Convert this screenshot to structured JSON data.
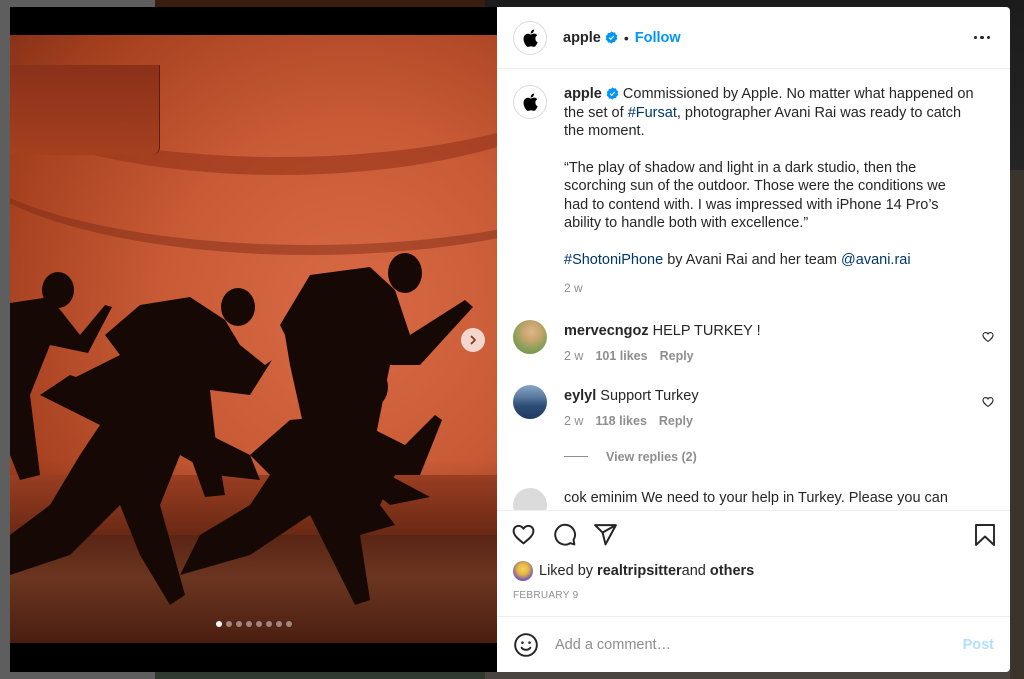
{
  "post": {
    "author": "apple",
    "verified": true,
    "separator": "•",
    "follow_label": "Follow",
    "media": {
      "slide_count": 8,
      "active_slide": 1
    },
    "caption": {
      "username": "apple",
      "line1": " Commissioned by Apple. No matter what happened on the set of ",
      "hashtag1": "#Fursat",
      "line1b": ", photographer Avani Rai was ready to catch the moment.",
      "quote": "“The play of shadow and light in a dark studio, then the scorching sun of the outdoor. Those were the conditions we had to contend with. I was impressed with iPhone 14 Pro’s ability to handle both with excellence.”",
      "hashtag2": "#ShotoniPhone",
      "by_text": " by Avani Rai and her team ",
      "mention": "@avani.rai",
      "time": "2 w"
    },
    "comments": [
      {
        "username": "mervecngoz",
        "text": " HELP TURKEY !",
        "time": "2 w",
        "likes": "101 likes",
        "reply": "Reply"
      },
      {
        "username": "eylyl",
        "text": " Support Turkey",
        "time": "2 w",
        "likes": "118 likes",
        "reply": "Reply"
      }
    ],
    "view_replies": "View replies (2)",
    "cut_comment": "cok eminim We need to your help in Turkey. Please you can",
    "liked_by": {
      "prefix": "Liked by ",
      "user": "realtripsitter",
      "middle": " and ",
      "others": "others"
    },
    "date": "FEBRUARY 9",
    "add_comment": {
      "placeholder": "Add a comment…",
      "value": "",
      "post_label": "Post"
    }
  },
  "colors": {
    "accent": "#0095f6",
    "link": "#00376b",
    "muted": "#8e8e8e",
    "post_disabled": "#b2dffc"
  },
  "icons": {
    "header_more": "more-horizontal-icon",
    "next": "chevron-right-icon",
    "like": "heart-icon",
    "comment": "comment-bubble-icon",
    "share": "paper-plane-icon",
    "save": "bookmark-icon",
    "emoji": "smiley-icon",
    "verified": "verified-badge-icon"
  }
}
